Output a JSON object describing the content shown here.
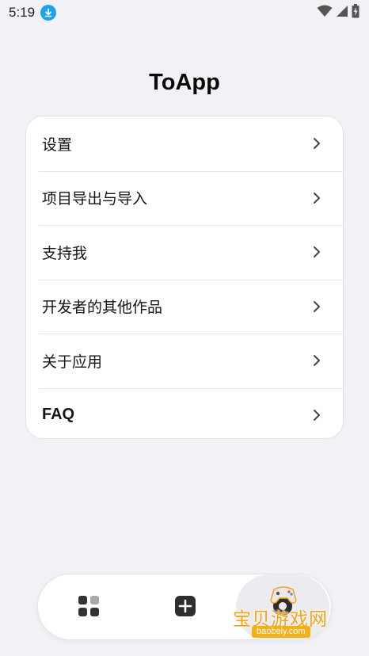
{
  "status_bar": {
    "time": "5:19",
    "icons": [
      "download-badge-icon",
      "wifi-icon",
      "signal-icon",
      "battery-charging-icon"
    ]
  },
  "app": {
    "title": "ToApp"
  },
  "menu": {
    "items": [
      {
        "label": "设置"
      },
      {
        "label": "项目导出与导入"
      },
      {
        "label": "支持我"
      },
      {
        "label": "开发者的其他作品"
      },
      {
        "label": "关于应用"
      },
      {
        "label": "FAQ"
      }
    ]
  },
  "bottom_nav": {
    "items": [
      "grid-icon",
      "add-square-icon",
      "settings-tab-icon"
    ]
  },
  "watermark": {
    "text": "宝贝游戏网",
    "url": "baobeiy.com"
  },
  "colors": {
    "background": "#f2f1f6",
    "card": "#ffffff",
    "download_badge": "#1aa3f0",
    "watermark": "#f4a315"
  }
}
